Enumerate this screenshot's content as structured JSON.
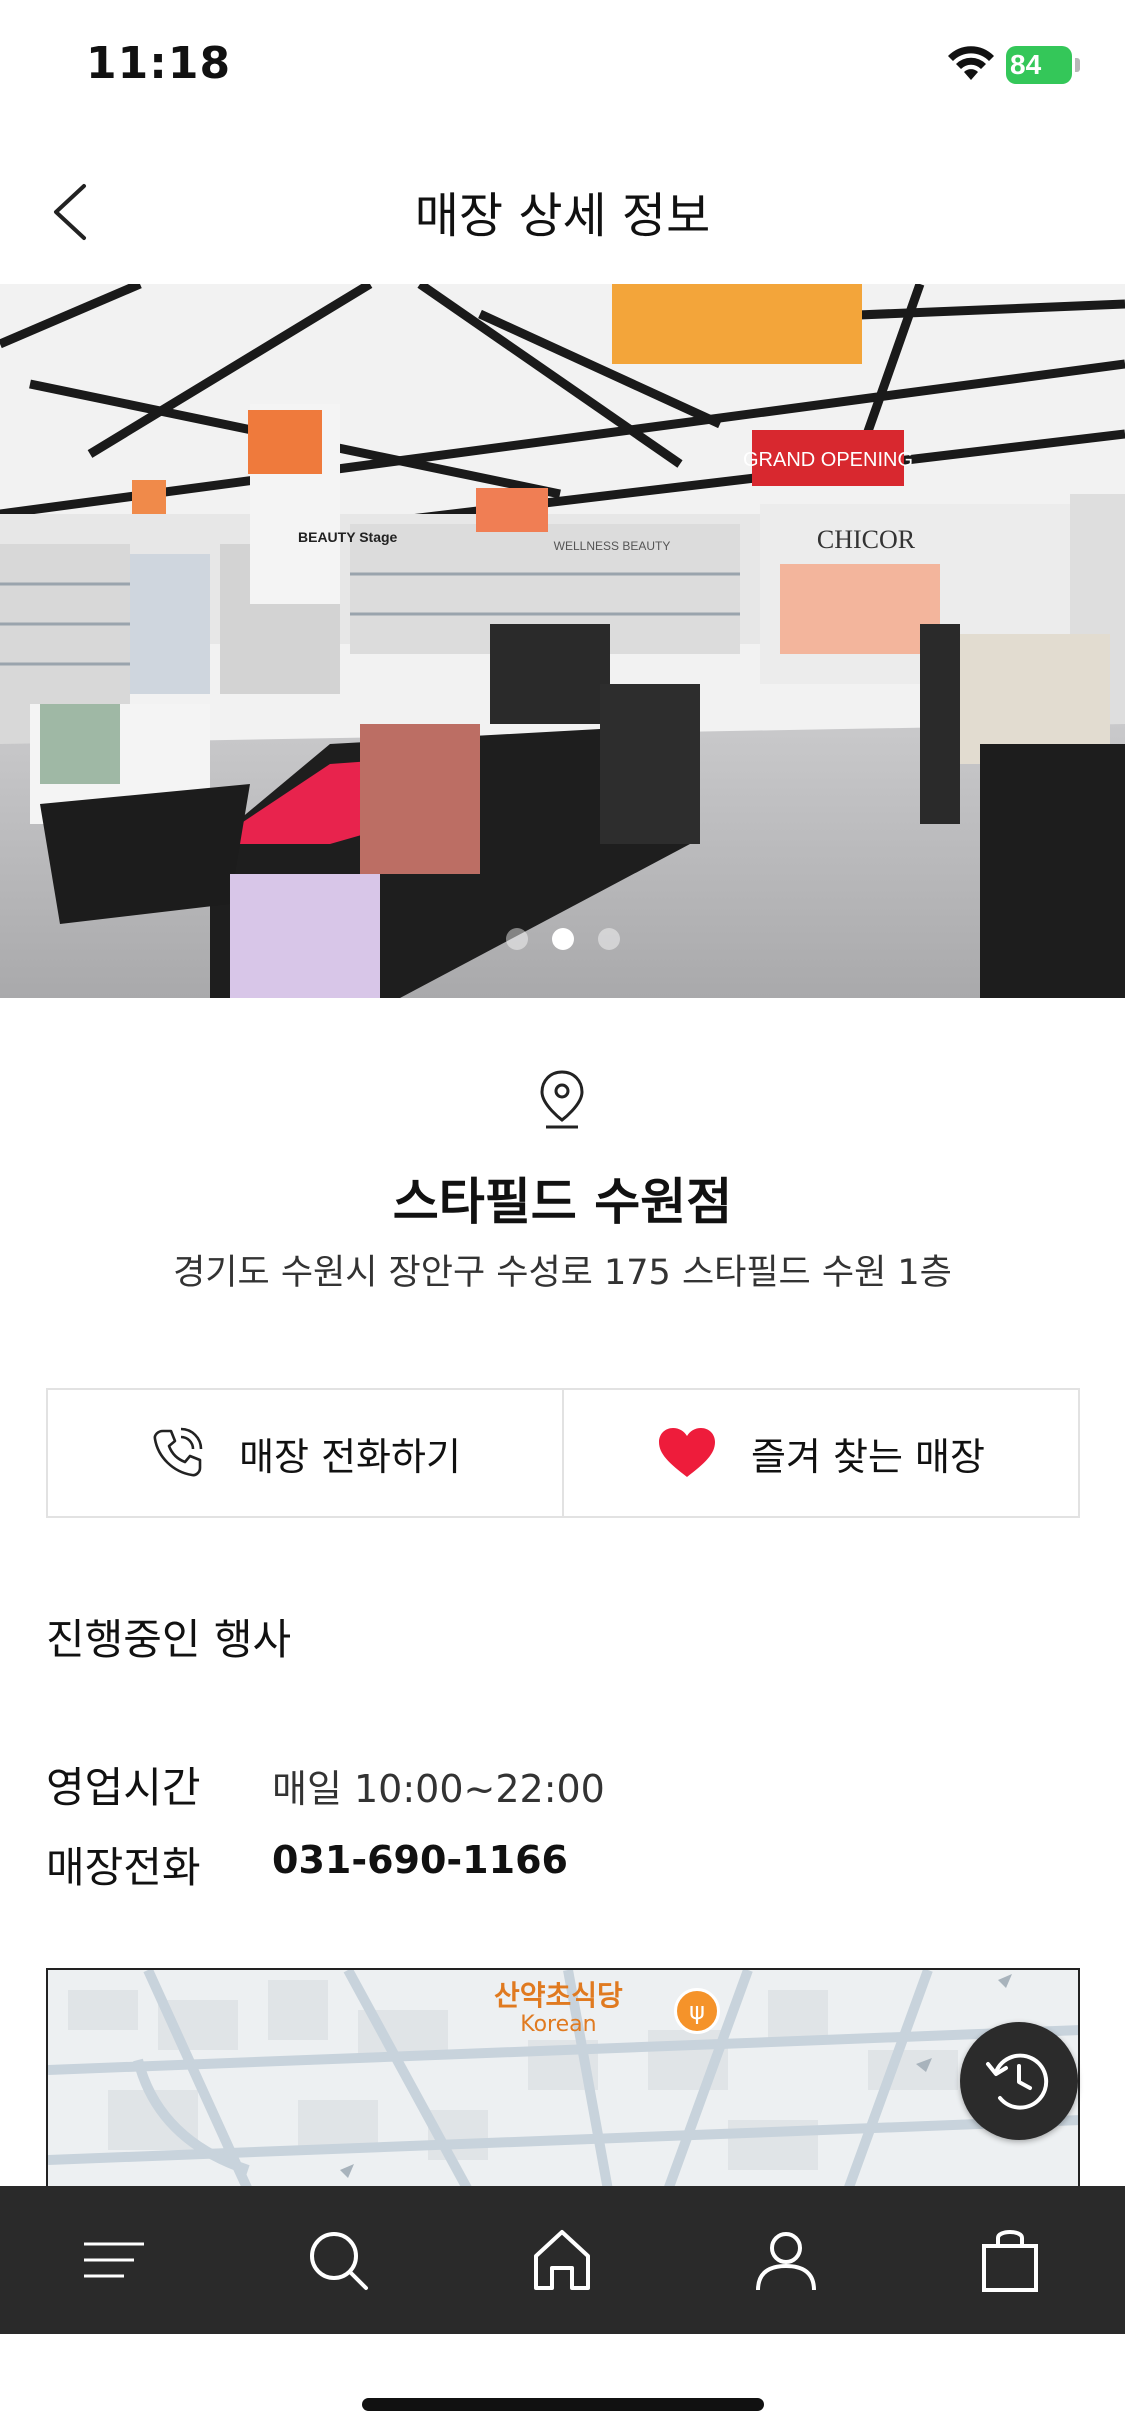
{
  "status_bar": {
    "time": "11:18",
    "battery": "84"
  },
  "header": {
    "title": "매장 상세 정보"
  },
  "hero": {
    "signs": [
      "BEAUTY Stage",
      "CHICOR",
      "WELLNESS BEAUTY",
      "GRAND OPENING"
    ],
    "active_slide": 2,
    "slide_count": 3
  },
  "store": {
    "name": "스타필드 수원점",
    "address": "경기도 수원시 장안구 수성로 175 스타필드 수원 1층"
  },
  "actions": {
    "call": "매장 전화하기",
    "favorite": "즐겨 찾는 매장"
  },
  "events": {
    "title": "진행중인 행사"
  },
  "info": {
    "hours_label": "영업시간",
    "hours_value": "매일 10:00~22:00",
    "phone_label": "매장전화",
    "phone_value": "031-690-1166"
  },
  "map": {
    "poi_name": "산약초식당",
    "poi_category": "Korean"
  },
  "tabs": [
    "menu-icon",
    "search-icon",
    "home-icon",
    "user-icon",
    "bag-icon"
  ],
  "colors": {
    "heart": "#ee1c3b",
    "tabbar": "#2a2a2a",
    "battery": "#34c759"
  }
}
